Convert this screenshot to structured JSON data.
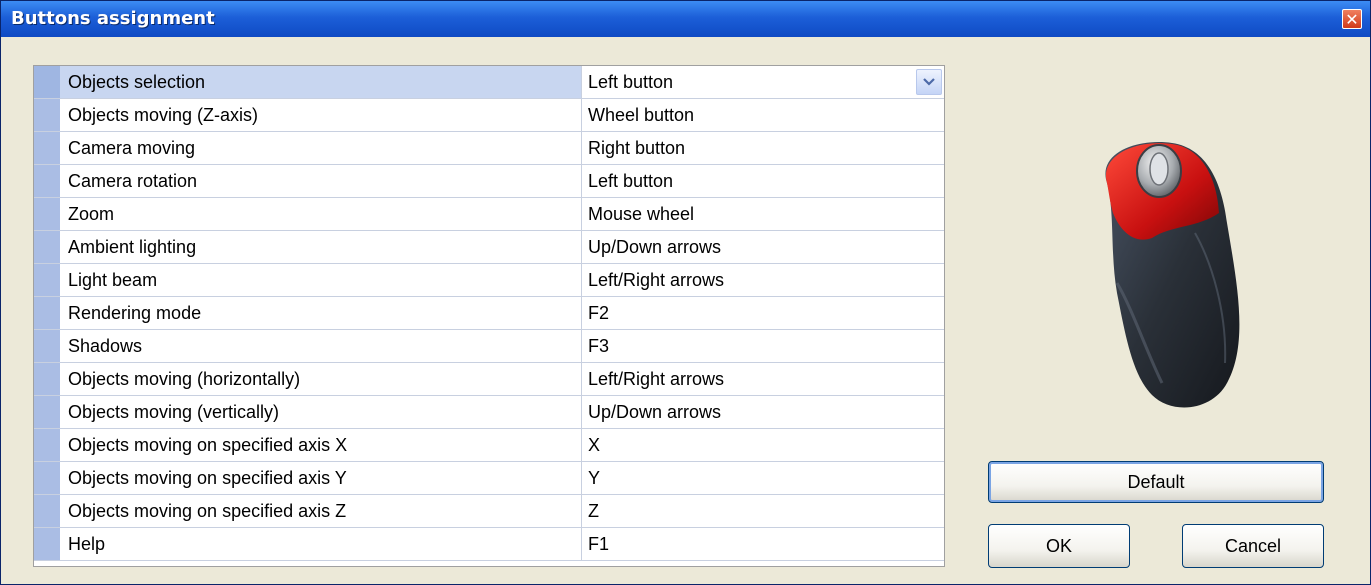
{
  "window": {
    "title": "Buttons assignment",
    "close_glyph": "✕"
  },
  "assignments": [
    {
      "action": "Objects selection",
      "button": "Left button"
    },
    {
      "action": "Objects moving (Z-axis)",
      "button": "Wheel button"
    },
    {
      "action": "Camera moving",
      "button": "Right button"
    },
    {
      "action": "Camera rotation",
      "button": "Left button"
    },
    {
      "action": "Zoom",
      "button": "Mouse wheel"
    },
    {
      "action": "Ambient lighting",
      "button": "Up/Down arrows"
    },
    {
      "action": "Light beam",
      "button": "Left/Right arrows"
    },
    {
      "action": "Rendering mode",
      "button": "F2"
    },
    {
      "action": "Shadows",
      "button": "F3"
    },
    {
      "action": "Objects moving (horizontally)",
      "button": "Left/Right arrows"
    },
    {
      "action": "Objects moving (vertically)",
      "button": "Up/Down arrows"
    },
    {
      "action": "Objects moving on specified axis X",
      "button": "X"
    },
    {
      "action": "Objects moving on specified axis Y",
      "button": "Y"
    },
    {
      "action": "Objects moving on specified axis Z",
      "button": "Z"
    },
    {
      "action": "Help",
      "button": "F1"
    }
  ],
  "buttons": {
    "default": "Default",
    "ok": "OK",
    "cancel": "Cancel"
  },
  "icons": {
    "close": "close-icon",
    "combo_arrow": "chevron-down-icon",
    "mouse": "mouse-image"
  },
  "colors": {
    "title_bar": "#1c5fd8",
    "row_indicator": "#aabde4",
    "selected_row": "#c8d6f0",
    "mouse_accent": "#c81010"
  }
}
